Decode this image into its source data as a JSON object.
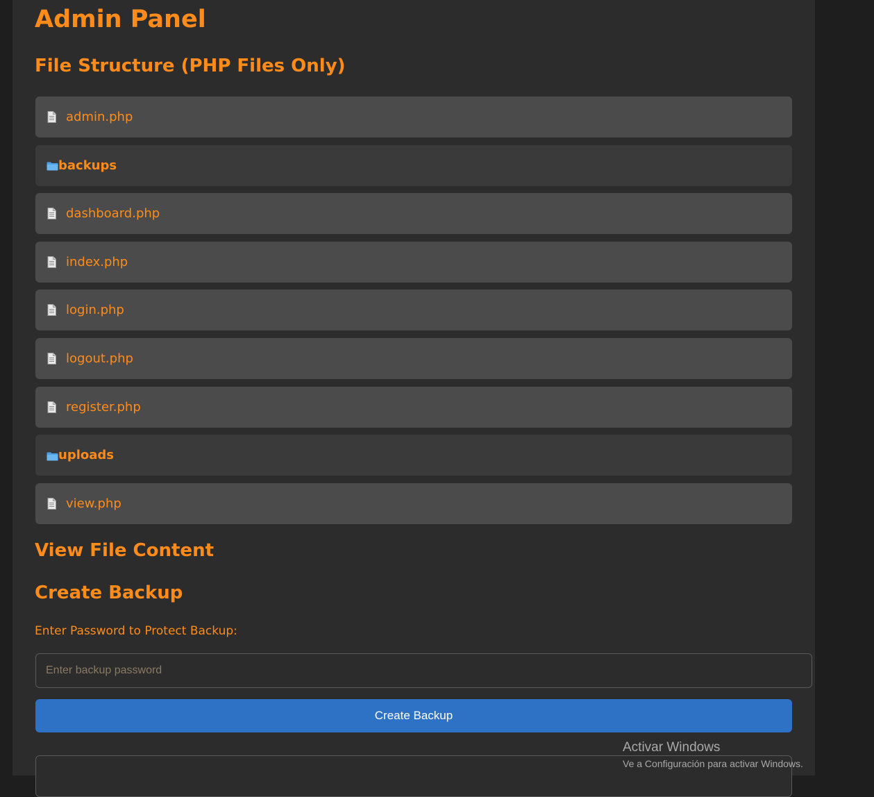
{
  "page": {
    "title": "Admin Panel",
    "file_structure_heading": "File Structure (PHP Files Only)",
    "view_heading": "View File Content",
    "backup_heading": "Create Backup"
  },
  "files": [
    {
      "type": "file",
      "icon": "document-icon",
      "name": "admin.php"
    },
    {
      "type": "dir",
      "icon": "folder-icon",
      "name": "backups"
    },
    {
      "type": "file",
      "icon": "document-icon",
      "name": "dashboard.php"
    },
    {
      "type": "file",
      "icon": "document-icon",
      "name": "index.php"
    },
    {
      "type": "file",
      "icon": "document-icon",
      "name": "login.php"
    },
    {
      "type": "file",
      "icon": "document-icon",
      "name": "logout.php"
    },
    {
      "type": "file",
      "icon": "document-icon",
      "name": "register.php"
    },
    {
      "type": "dir",
      "icon": "folder-icon",
      "name": "uploads"
    },
    {
      "type": "file",
      "icon": "document-icon",
      "name": "view.php"
    }
  ],
  "backup": {
    "password_label": "Enter Password to Protect Backup:",
    "password_placeholder": "Enter backup password",
    "password_value": "",
    "button_label": "Create Backup"
  },
  "watermark": {
    "title": "Activar Windows",
    "subtitle": "Ve a Configuración para activar Windows."
  },
  "colors": {
    "accent": "#ff8c1a",
    "button": "#2d72c4",
    "file_row": "#4b4b4b",
    "dir_row": "#3a3a3a",
    "panel": "#2c2c2c",
    "background": "#1e1e1e"
  }
}
